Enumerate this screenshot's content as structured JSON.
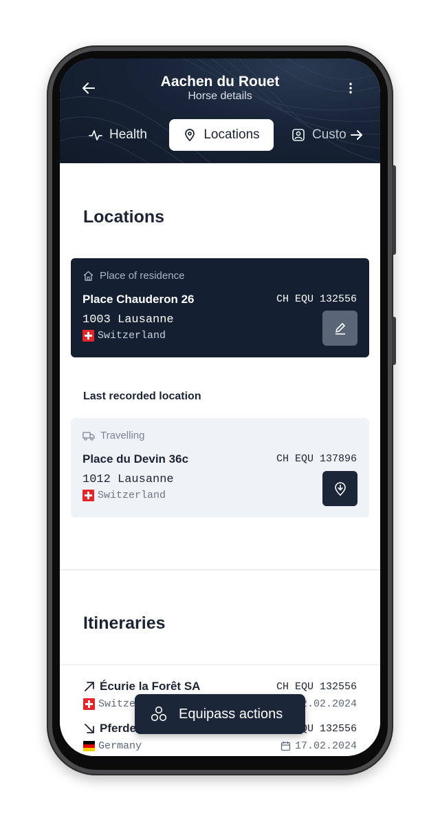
{
  "header": {
    "title": "Aachen du Rouet",
    "subtitle": "Horse details",
    "icons": {
      "back": "arrow-left-icon",
      "menu": "more-vertical-icon"
    }
  },
  "tabs": [
    {
      "label": "Health",
      "icon": "activity-icon",
      "active": false
    },
    {
      "label": "Locations",
      "icon": "map-pin-icon",
      "active": true
    },
    {
      "label": "Custo",
      "icon": "user-badge-icon",
      "active": false
    }
  ],
  "tabs_scroll_icon": "arrow-right-icon",
  "locations": {
    "heading": "Locations",
    "residence": {
      "kind": "Place of residence",
      "kind_icon": "home-icon",
      "street": "Place Chauderon 26",
      "id": "CH EQU 132556",
      "city": "1003 Lausanne",
      "country": "Switzerland",
      "action_icon": "edit-pencil-icon"
    },
    "last_recorded_heading": "Last recorded location",
    "last_recorded": {
      "kind": "Travelling",
      "kind_icon": "truck-icon",
      "street": "Place du Devin 36c",
      "id": "CH EQU 137896",
      "city": "1012 Lausanne",
      "country": "Switzerland",
      "action_icon": "location-download-icon"
    }
  },
  "itineraries": {
    "heading": "Itineraries",
    "items": [
      {
        "direction_icon": "arrow-up-right-icon",
        "name": "Écurie la Forêt SA",
        "id": "CH EQU 132556",
        "country": "Switze",
        "date": "2.02.2024"
      },
      {
        "direction_icon": "arrow-down-right-icon",
        "name": "Pferde",
        "id": "QU 132556",
        "country": "Germany",
        "date": "17.02.2024"
      }
    ]
  },
  "fab": {
    "label": "Equipass actions",
    "icon": "circles-icon"
  },
  "colors": {
    "primary_dark": "#141f31",
    "light_card": "#eff3f8",
    "accent_red": "#e4262b"
  }
}
